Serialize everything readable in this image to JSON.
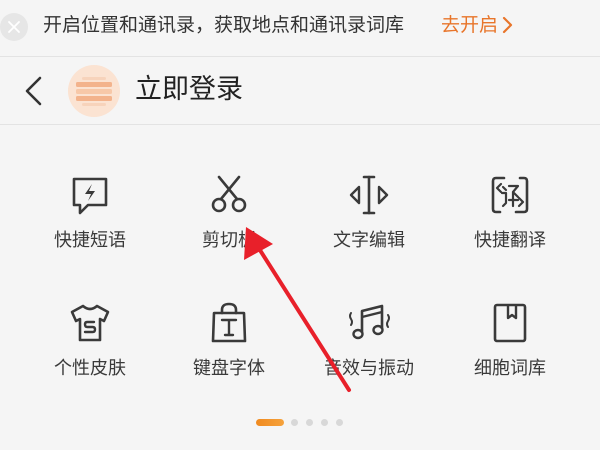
{
  "notice": {
    "text": "开启位置和通讯录，获取地点和通讯录词库",
    "action_label": "去开启",
    "close_icon": "close-icon",
    "action_color": "#e8752a"
  },
  "header": {
    "title": "立即登录",
    "back_icon": "chevron-left-icon"
  },
  "grid": {
    "items": [
      {
        "label": "快捷短语",
        "icon": "quick-phrase-icon"
      },
      {
        "label": "剪切板",
        "icon": "scissors-icon"
      },
      {
        "label": "文字编辑",
        "icon": "text-edit-icon"
      },
      {
        "label": "快捷翻译",
        "icon": "translate-icon"
      },
      {
        "label": "个性皮肤",
        "icon": "tshirt-icon"
      },
      {
        "label": "键盘字体",
        "icon": "font-bag-icon"
      },
      {
        "label": "音效与振动",
        "icon": "music-note-icon"
      },
      {
        "label": "细胞词库",
        "icon": "book-icon"
      }
    ]
  },
  "pager": {
    "pages": 5,
    "active_page": 1,
    "active_color": "#f08a1f"
  },
  "annotation": {
    "arrow_color": "#e8202a"
  }
}
